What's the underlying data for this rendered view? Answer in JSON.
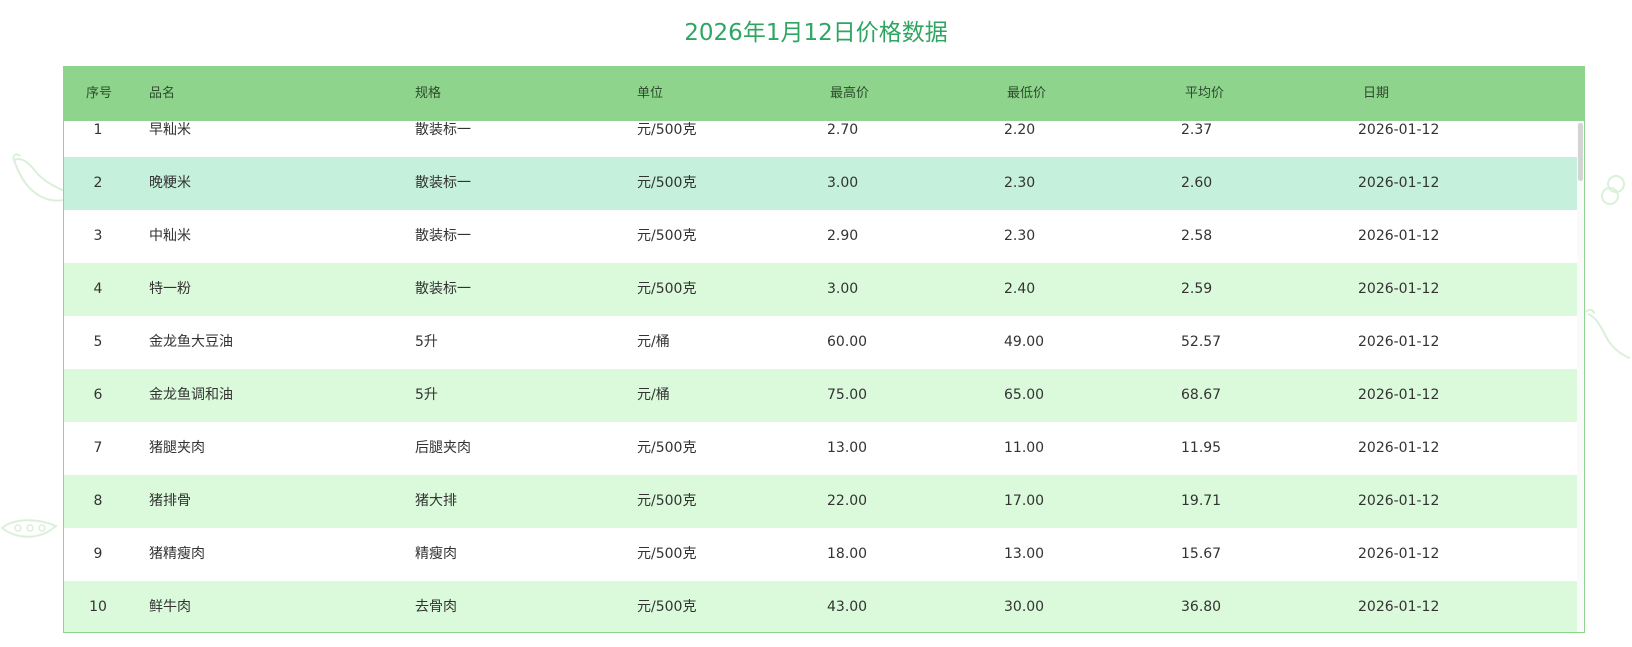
{
  "title": "2026年1月12日价格数据",
  "columns": [
    "序号",
    "品名",
    "规格",
    "单位",
    "最高价",
    "最低价",
    "平均价",
    "日期"
  ],
  "rows": [
    {
      "no": "1",
      "name": "早籼米",
      "spec": "散装标一",
      "unit": "元/500克",
      "high": "2.70",
      "low": "2.20",
      "avg": "2.37",
      "date": "2026-01-12"
    },
    {
      "no": "2",
      "name": "晚粳米",
      "spec": "散装标一",
      "unit": "元/500克",
      "high": "3.00",
      "low": "2.30",
      "avg": "2.60",
      "date": "2026-01-12"
    },
    {
      "no": "3",
      "name": "中籼米",
      "spec": "散装标一",
      "unit": "元/500克",
      "high": "2.90",
      "low": "2.30",
      "avg": "2.58",
      "date": "2026-01-12"
    },
    {
      "no": "4",
      "name": "特一粉",
      "spec": "散装标一",
      "unit": "元/500克",
      "high": "3.00",
      "low": "2.40",
      "avg": "2.59",
      "date": "2026-01-12"
    },
    {
      "no": "5",
      "name": "金龙鱼大豆油",
      "spec": "5升",
      "unit": "元/桶",
      "high": "60.00",
      "low": "49.00",
      "avg": "52.57",
      "date": "2026-01-12"
    },
    {
      "no": "6",
      "name": "金龙鱼调和油",
      "spec": "5升",
      "unit": "元/桶",
      "high": "75.00",
      "low": "65.00",
      "avg": "68.67",
      "date": "2026-01-12"
    },
    {
      "no": "7",
      "name": "猪腿夹肉",
      "spec": "后腿夹肉",
      "unit": "元/500克",
      "high": "13.00",
      "low": "11.00",
      "avg": "11.95",
      "date": "2026-01-12"
    },
    {
      "no": "8",
      "name": "猪排骨",
      "spec": "猪大排",
      "unit": "元/500克",
      "high": "22.00",
      "low": "17.00",
      "avg": "19.71",
      "date": "2026-01-12"
    },
    {
      "no": "9",
      "name": "猪精瘦肉",
      "spec": "精瘦肉",
      "unit": "元/500克",
      "high": "18.00",
      "low": "13.00",
      "avg": "15.67",
      "date": "2026-01-12"
    },
    {
      "no": "10",
      "name": "鲜牛肉",
      "spec": "去骨肉",
      "unit": "元/500克",
      "high": "43.00",
      "low": "30.00",
      "avg": "36.80",
      "date": "2026-01-12"
    }
  ],
  "colors": {
    "title": "#2ea662",
    "header_bg": "#8fd48d",
    "row_alt_bg": "#dbfadb",
    "row_selected_bg": "#c5f0db",
    "border": "#8fd48d"
  },
  "icons": [
    "eggplant-decoration-icon",
    "peapod-decoration-icon",
    "vegetable-decoration-icon"
  ]
}
